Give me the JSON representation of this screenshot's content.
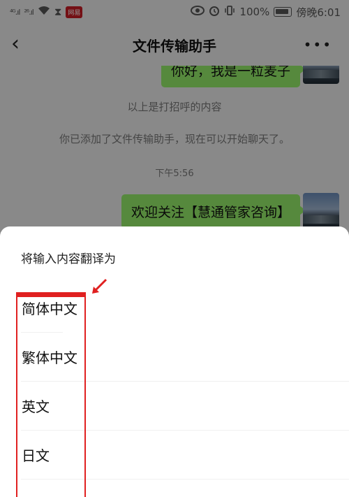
{
  "status_bar": {
    "signal_1": "⁴ᴳ.ıl",
    "signal_2": "²⁶.ıl",
    "app_badge": "网易",
    "battery_pct": "100%",
    "right_text": "傍晚6:01"
  },
  "nav": {
    "back_icon": "‹",
    "title": "文件传输助手",
    "more_icon": "•••"
  },
  "chat": {
    "messages": [
      {
        "text": "你好，我是一粒麦子"
      },
      {
        "text": "欢迎关注【慧通管家咨询】"
      }
    ],
    "system_messages": [
      "以上是打招呼的内容",
      "你已添加了文件传输助手，现在可以开始聊天了。"
    ],
    "time_label": "下午5:56"
  },
  "sheet": {
    "title": "将输入内容翻译为",
    "options": [
      {
        "label": "简体中文"
      },
      {
        "label": "繁体中文"
      },
      {
        "label": "英文"
      },
      {
        "label": "日文"
      }
    ]
  },
  "colors": {
    "bubble_green": "#95ec69",
    "annotation_red": "#e02020",
    "background": "#ededed"
  }
}
